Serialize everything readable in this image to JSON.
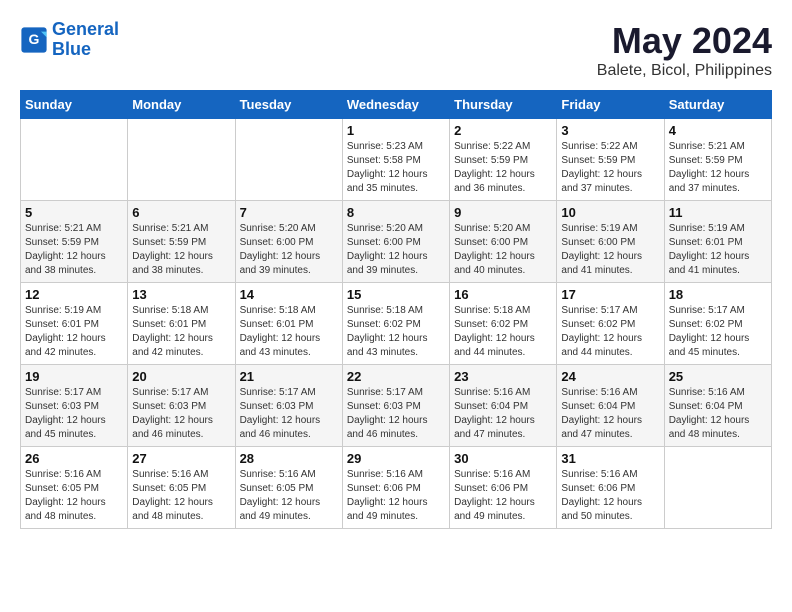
{
  "header": {
    "logo_line1": "General",
    "logo_line2": "Blue",
    "main_title": "May 2024",
    "subtitle": "Balete, Bicol, Philippines"
  },
  "weekdays": [
    "Sunday",
    "Monday",
    "Tuesday",
    "Wednesday",
    "Thursday",
    "Friday",
    "Saturday"
  ],
  "weeks": [
    [
      {
        "day": "",
        "sunrise": "",
        "sunset": "",
        "daylight": "",
        "empty": true
      },
      {
        "day": "",
        "sunrise": "",
        "sunset": "",
        "daylight": "",
        "empty": true
      },
      {
        "day": "",
        "sunrise": "",
        "sunset": "",
        "daylight": "",
        "empty": true
      },
      {
        "day": "1",
        "sunrise": "Sunrise: 5:23 AM",
        "sunset": "Sunset: 5:58 PM",
        "daylight": "Daylight: 12 hours and 35 minutes."
      },
      {
        "day": "2",
        "sunrise": "Sunrise: 5:22 AM",
        "sunset": "Sunset: 5:59 PM",
        "daylight": "Daylight: 12 hours and 36 minutes."
      },
      {
        "day": "3",
        "sunrise": "Sunrise: 5:22 AM",
        "sunset": "Sunset: 5:59 PM",
        "daylight": "Daylight: 12 hours and 37 minutes."
      },
      {
        "day": "4",
        "sunrise": "Sunrise: 5:21 AM",
        "sunset": "Sunset: 5:59 PM",
        "daylight": "Daylight: 12 hours and 37 minutes."
      }
    ],
    [
      {
        "day": "5",
        "sunrise": "Sunrise: 5:21 AM",
        "sunset": "Sunset: 5:59 PM",
        "daylight": "Daylight: 12 hours and 38 minutes."
      },
      {
        "day": "6",
        "sunrise": "Sunrise: 5:21 AM",
        "sunset": "Sunset: 5:59 PM",
        "daylight": "Daylight: 12 hours and 38 minutes."
      },
      {
        "day": "7",
        "sunrise": "Sunrise: 5:20 AM",
        "sunset": "Sunset: 6:00 PM",
        "daylight": "Daylight: 12 hours and 39 minutes."
      },
      {
        "day": "8",
        "sunrise": "Sunrise: 5:20 AM",
        "sunset": "Sunset: 6:00 PM",
        "daylight": "Daylight: 12 hours and 39 minutes."
      },
      {
        "day": "9",
        "sunrise": "Sunrise: 5:20 AM",
        "sunset": "Sunset: 6:00 PM",
        "daylight": "Daylight: 12 hours and 40 minutes."
      },
      {
        "day": "10",
        "sunrise": "Sunrise: 5:19 AM",
        "sunset": "Sunset: 6:00 PM",
        "daylight": "Daylight: 12 hours and 41 minutes."
      },
      {
        "day": "11",
        "sunrise": "Sunrise: 5:19 AM",
        "sunset": "Sunset: 6:01 PM",
        "daylight": "Daylight: 12 hours and 41 minutes."
      }
    ],
    [
      {
        "day": "12",
        "sunrise": "Sunrise: 5:19 AM",
        "sunset": "Sunset: 6:01 PM",
        "daylight": "Daylight: 12 hours and 42 minutes."
      },
      {
        "day": "13",
        "sunrise": "Sunrise: 5:18 AM",
        "sunset": "Sunset: 6:01 PM",
        "daylight": "Daylight: 12 hours and 42 minutes."
      },
      {
        "day": "14",
        "sunrise": "Sunrise: 5:18 AM",
        "sunset": "Sunset: 6:01 PM",
        "daylight": "Daylight: 12 hours and 43 minutes."
      },
      {
        "day": "15",
        "sunrise": "Sunrise: 5:18 AM",
        "sunset": "Sunset: 6:02 PM",
        "daylight": "Daylight: 12 hours and 43 minutes."
      },
      {
        "day": "16",
        "sunrise": "Sunrise: 5:18 AM",
        "sunset": "Sunset: 6:02 PM",
        "daylight": "Daylight: 12 hours and 44 minutes."
      },
      {
        "day": "17",
        "sunrise": "Sunrise: 5:17 AM",
        "sunset": "Sunset: 6:02 PM",
        "daylight": "Daylight: 12 hours and 44 minutes."
      },
      {
        "day": "18",
        "sunrise": "Sunrise: 5:17 AM",
        "sunset": "Sunset: 6:02 PM",
        "daylight": "Daylight: 12 hours and 45 minutes."
      }
    ],
    [
      {
        "day": "19",
        "sunrise": "Sunrise: 5:17 AM",
        "sunset": "Sunset: 6:03 PM",
        "daylight": "Daylight: 12 hours and 45 minutes."
      },
      {
        "day": "20",
        "sunrise": "Sunrise: 5:17 AM",
        "sunset": "Sunset: 6:03 PM",
        "daylight": "Daylight: 12 hours and 46 minutes."
      },
      {
        "day": "21",
        "sunrise": "Sunrise: 5:17 AM",
        "sunset": "Sunset: 6:03 PM",
        "daylight": "Daylight: 12 hours and 46 minutes."
      },
      {
        "day": "22",
        "sunrise": "Sunrise: 5:17 AM",
        "sunset": "Sunset: 6:03 PM",
        "daylight": "Daylight: 12 hours and 46 minutes."
      },
      {
        "day": "23",
        "sunrise": "Sunrise: 5:16 AM",
        "sunset": "Sunset: 6:04 PM",
        "daylight": "Daylight: 12 hours and 47 minutes."
      },
      {
        "day": "24",
        "sunrise": "Sunrise: 5:16 AM",
        "sunset": "Sunset: 6:04 PM",
        "daylight": "Daylight: 12 hours and 47 minutes."
      },
      {
        "day": "25",
        "sunrise": "Sunrise: 5:16 AM",
        "sunset": "Sunset: 6:04 PM",
        "daylight": "Daylight: 12 hours and 48 minutes."
      }
    ],
    [
      {
        "day": "26",
        "sunrise": "Sunrise: 5:16 AM",
        "sunset": "Sunset: 6:05 PM",
        "daylight": "Daylight: 12 hours and 48 minutes."
      },
      {
        "day": "27",
        "sunrise": "Sunrise: 5:16 AM",
        "sunset": "Sunset: 6:05 PM",
        "daylight": "Daylight: 12 hours and 48 minutes."
      },
      {
        "day": "28",
        "sunrise": "Sunrise: 5:16 AM",
        "sunset": "Sunset: 6:05 PM",
        "daylight": "Daylight: 12 hours and 49 minutes."
      },
      {
        "day": "29",
        "sunrise": "Sunrise: 5:16 AM",
        "sunset": "Sunset: 6:06 PM",
        "daylight": "Daylight: 12 hours and 49 minutes."
      },
      {
        "day": "30",
        "sunrise": "Sunrise: 5:16 AM",
        "sunset": "Sunset: 6:06 PM",
        "daylight": "Daylight: 12 hours and 49 minutes."
      },
      {
        "day": "31",
        "sunrise": "Sunrise: 5:16 AM",
        "sunset": "Sunset: 6:06 PM",
        "daylight": "Daylight: 12 hours and 50 minutes."
      },
      {
        "day": "",
        "sunrise": "",
        "sunset": "",
        "daylight": "",
        "empty": true
      }
    ]
  ]
}
